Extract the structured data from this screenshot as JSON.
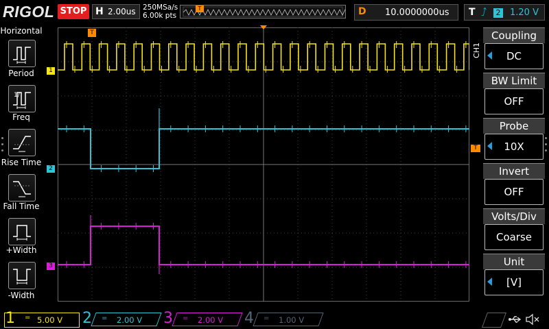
{
  "header": {
    "brand": "RIGOL",
    "run_status": "STOP",
    "timebase_key": "H",
    "timebase_value": "2.00us",
    "sample_rate": "250MSa/s",
    "memory_depth": "6.00k pts",
    "delay_key": "D",
    "delay_value": "10.0000000us",
    "trigger_key": "T",
    "trigger_source": "2",
    "trigger_level": "1.20 V",
    "trigger_position_marker": "T"
  },
  "left_menu": {
    "title": "Horizontal",
    "items": [
      {
        "label": "Period",
        "icon": "period-icon"
      },
      {
        "label": "Freq",
        "icon": "frequency-icon"
      },
      {
        "label": "Rise Time",
        "icon": "rise-time-icon"
      },
      {
        "label": "Fall Time",
        "icon": "fall-time-icon"
      },
      {
        "label": "+Width",
        "icon": "positive-width-icon"
      },
      {
        "label": "-Width",
        "icon": "negative-width-icon"
      }
    ]
  },
  "channel_markers": {
    "ch1": "1",
    "ch2": "2",
    "ch3": "3",
    "trigger": "T"
  },
  "right_menu": {
    "channel_label": "CH1",
    "items": [
      {
        "title": "Coupling",
        "value": "DC",
        "has_arrow": true
      },
      {
        "title": "BW Limit",
        "value": "OFF",
        "has_arrow": false
      },
      {
        "title": "Probe",
        "value": "10X",
        "has_arrow": true
      },
      {
        "title": "Invert",
        "value": "OFF",
        "has_arrow": false
      },
      {
        "title": "Volts/Div",
        "value": "Coarse",
        "has_arrow": false
      },
      {
        "title": "Unit",
        "value": "[V]",
        "has_arrow": true
      }
    ]
  },
  "channels": [
    {
      "number": "1",
      "scale": "5.00 V",
      "color": "#f5e614",
      "active": true
    },
    {
      "number": "2",
      "scale": "2.00 V",
      "color": "#2ec4d6",
      "active": true
    },
    {
      "number": "3",
      "scale": "2.00 V",
      "color": "#d61fd6",
      "active": true
    },
    {
      "number": "4",
      "scale": "1.00 V",
      "color": "#556677",
      "active": false
    }
  ],
  "colors": {
    "ch1": "#f5e614",
    "ch2": "#2ec4d6",
    "ch3": "#d61fd6",
    "trigger": "#ff8a00",
    "stop": "#e31e1e"
  },
  "status_icons": [
    "usb-icon",
    "sound-mute-icon"
  ]
}
